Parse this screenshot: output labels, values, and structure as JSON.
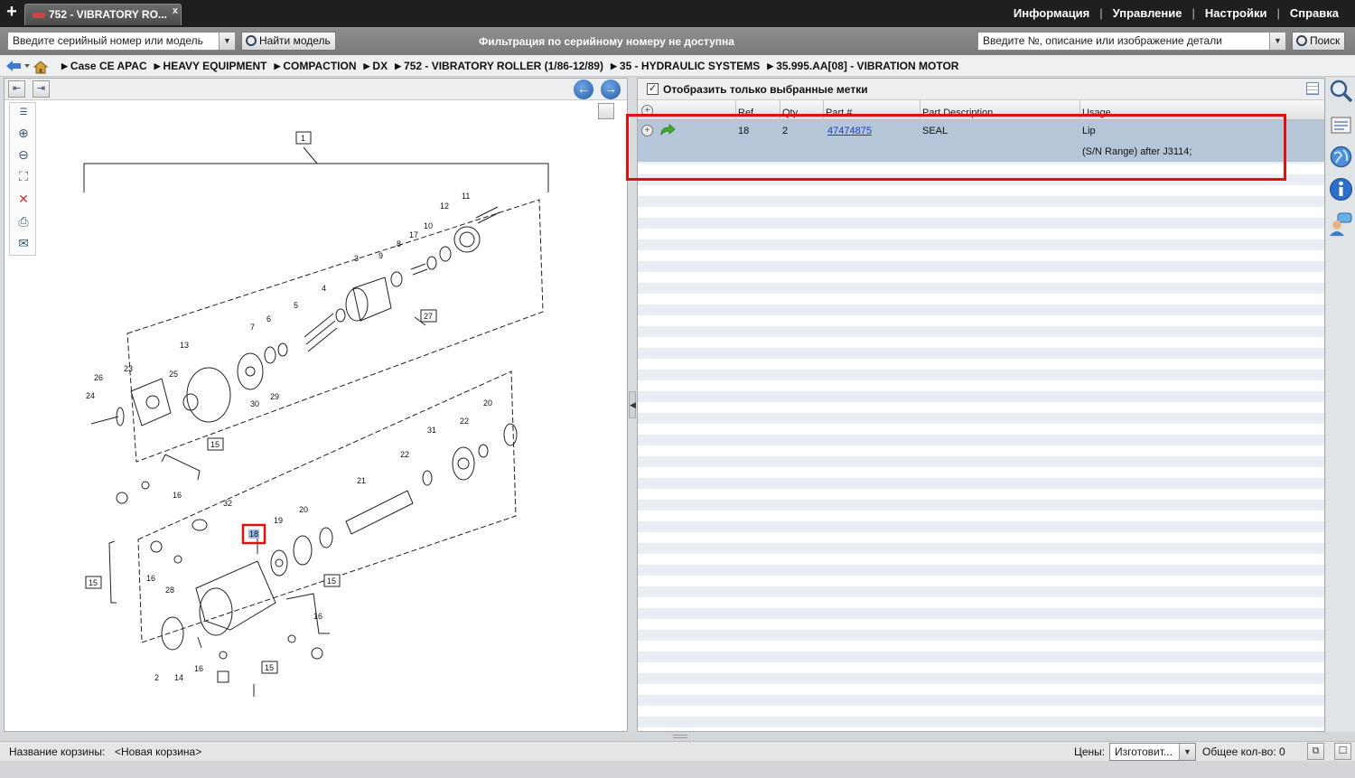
{
  "tab": {
    "title": "752 - VIBRATORY RO...",
    "close": "x"
  },
  "top_menu": [
    "Информация",
    "Управление",
    "Настройки",
    "Справка"
  ],
  "toolbar": {
    "serial_placeholder": "Введите серийный номер или модель",
    "find_model_label": "Найти модель",
    "filter_message": "Фильтрация по серийному номеру не доступна",
    "part_search_placeholder": "Введите №, описание или изображение детали",
    "search_label": "Поиск"
  },
  "breadcrumb": [
    "Case CE APAC",
    "HEAVY EQUIPMENT",
    "COMPACTION",
    "DX",
    "752 - VIBRATORY ROLLER (1/86-12/89)",
    "35 - HYDRAULIC SYSTEMS",
    "35.995.AA[08] - VIBRATION MOTOR"
  ],
  "right_panel": {
    "show_selected_label": "Отобразить только выбранные метки",
    "show_selected_checked": true,
    "columns": [
      "Ref",
      "Qty",
      "Part #",
      "Part Description",
      "Usage"
    ],
    "rows": [
      {
        "ref": "18",
        "qty": "2",
        "part": "47474875",
        "description": "SEAL",
        "usage": "Lip",
        "usage_note": "(S/N Range) after J3114;"
      }
    ]
  },
  "diagram": {
    "callouts": [
      "1",
      "2",
      "3",
      "4",
      "5",
      "6",
      "7",
      "8",
      "9",
      "10",
      "11",
      "12",
      "13",
      "14",
      "15",
      "16",
      "17",
      "18",
      "19",
      "20",
      "21",
      "22",
      "23",
      "24",
      "25",
      "26",
      "27",
      "28",
      "29",
      "30",
      "31",
      "32"
    ],
    "selected_callout": "18"
  },
  "status": {
    "cart_label": "Название корзины:",
    "cart_name": "<Новая корзина>",
    "prices_label": "Цены:",
    "prices_value": "Изготовит...",
    "total_label": "Общее кол-во: 0"
  },
  "colors": {
    "accent_highlight": "#e01010",
    "selected_row": "#b4c6d7",
    "link": "#1a3fc6"
  }
}
